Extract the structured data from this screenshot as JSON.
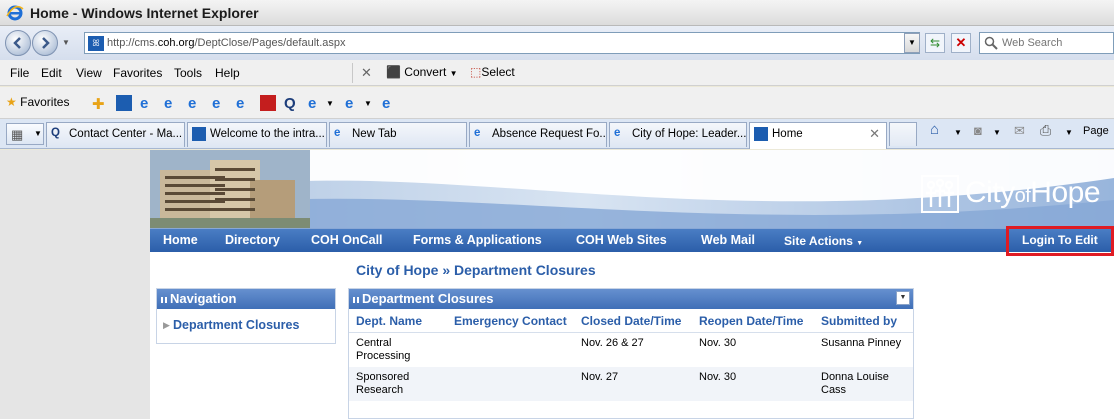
{
  "window": {
    "title": "Home - Windows Internet Explorer"
  },
  "address_bar": {
    "url_prefix": "http://cms.",
    "url_domain": "coh.org",
    "url_path": "/DeptClose/Pages/default.aspx",
    "search_placeholder": "Web Search"
  },
  "menu": {
    "items": [
      "File",
      "Edit",
      "View",
      "Favorites",
      "Tools",
      "Help"
    ],
    "convert_label": "Convert",
    "select_label": "Select"
  },
  "favorites_bar": {
    "label": "Favorites"
  },
  "tabs": [
    {
      "label": "Contact Center - Ma..."
    },
    {
      "label": "Welcome to the intra..."
    },
    {
      "label": "New Tab"
    },
    {
      "label": "Absence Request Fo..."
    },
    {
      "label": "City of Hope: Leader..."
    },
    {
      "label": "Home"
    }
  ],
  "command_bar": {
    "page_label": "Page"
  },
  "site": {
    "logo_text_a": "City",
    "logo_text_b": "of",
    "logo_text_c": "Hope",
    "nav": [
      "Home",
      "Directory",
      "COH OnCall",
      "Forms & Applications",
      "COH Web Sites",
      "Web Mail",
      "Site Actions"
    ],
    "login_label": "Login To Edit",
    "breadcrumb": "City of Hope » Department Closures"
  },
  "navigation_panel": {
    "title": "Navigation",
    "items": [
      "Department Closures"
    ]
  },
  "closures_panel": {
    "title": "Department Closures",
    "columns": [
      "Dept. Name",
      "Emergency Contact",
      "Closed Date/Time",
      "Reopen Date/Time",
      "Submitted by"
    ],
    "rows": [
      {
        "dept": "Central Processing",
        "contact": "",
        "closed": "Nov. 26 & 27",
        "reopen": "Nov. 30",
        "submitted": "Susanna Pinney"
      },
      {
        "dept": "Sponsored Research",
        "contact": "",
        "closed": "Nov. 27",
        "reopen": "Nov. 30",
        "submitted": "Donna Louise Cass"
      }
    ]
  },
  "colors": {
    "brand_blue": "#2b5ea9",
    "highlight_red": "#e01b23"
  }
}
